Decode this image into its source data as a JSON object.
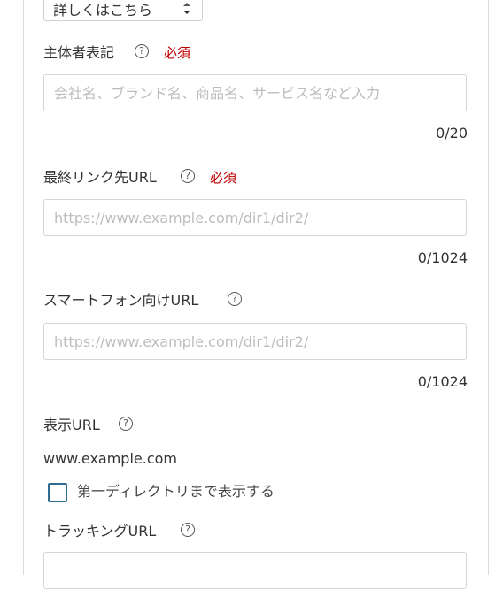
{
  "top_select": {
    "value": "詳しくはこちら"
  },
  "advertiser": {
    "label": "主体者表記",
    "required": "必須",
    "help": "?",
    "placeholder": "会社名、ブランド名、商品名、サービス名など入力",
    "value": "",
    "counter": "0/20"
  },
  "final_url": {
    "label": "最終リンク先URL",
    "required": "必須",
    "help": "?",
    "placeholder": "https://www.example.com/dir1/dir2/",
    "value": "",
    "counter": "0/1024"
  },
  "smartphone_url": {
    "label": "スマートフォン向けURL",
    "help": "?",
    "placeholder": "https://www.example.com/dir1/dir2/",
    "value": "",
    "counter": "0/1024"
  },
  "display_url": {
    "label": "表示URL",
    "help": "?",
    "value": "www.example.com",
    "checkbox_label": "第一ディレクトリまで表示する",
    "checkbox_checked": false
  },
  "tracking_url": {
    "label": "トラッキングURL",
    "help": "?"
  },
  "colors": {
    "required": "#c00000",
    "checkbox_border": "#2f6d8f",
    "placeholder": "#bdbdbd"
  }
}
